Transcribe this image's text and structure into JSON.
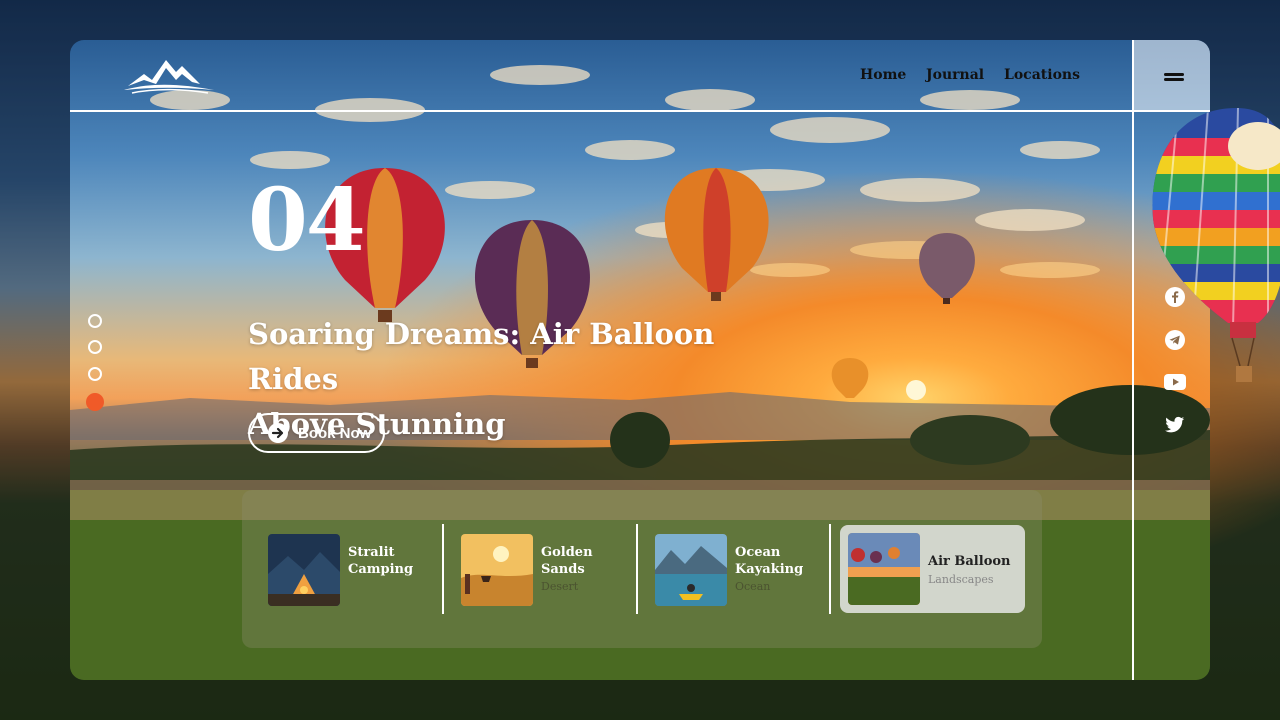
{
  "nav": {
    "items": [
      "Home",
      "Journal",
      "Locations"
    ]
  },
  "hero": {
    "slide_number": "04",
    "headline_line1": "Soaring Dreams: Air Balloon Rides",
    "headline_line2": "Above Stunning",
    "cta_label": "Book Now"
  },
  "slider": {
    "total": 4,
    "active_index": 3
  },
  "social": [
    "facebook-icon",
    "telegram-icon",
    "youtube-icon",
    "twitter-icon"
  ],
  "destinations": [
    {
      "title_line1": "Stralit",
      "title_line2": "Camping",
      "category": ""
    },
    {
      "title_line1": "Golden",
      "title_line2": "Sands",
      "category": "Desert"
    },
    {
      "title_line1": "Ocean",
      "title_line2": "Kayaking",
      "category": "Ocean"
    },
    {
      "title_line1": "Air Balloon",
      "title_line2": "",
      "category": "Landscapes",
      "active": true
    }
  ],
  "colors": {
    "accent": "#f05a28",
    "text_light": "#ffffff",
    "nav_text": "#111111"
  }
}
